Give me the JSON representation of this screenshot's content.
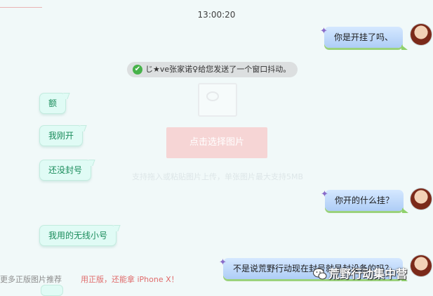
{
  "timestamp": "13:00:20",
  "upload": {
    "button_label": "点击选择图片",
    "hint": "支持拖入或粘贴图片上传，单张图片最大支持5MB"
  },
  "messages": [
    {
      "side": "right",
      "text": "你是开挂了吗、"
    },
    {
      "side": "left",
      "text": "额"
    },
    {
      "side": "left",
      "text": "我刚开"
    },
    {
      "side": "left",
      "text": "还没封号"
    },
    {
      "side": "right",
      "text": "你开的什么挂？"
    },
    {
      "side": "left",
      "text": "我用的无线小号"
    },
    {
      "side": "right",
      "text": "不是说荒野行动现在封号就是封设备的吗？"
    }
  ],
  "system_notice": {
    "text": "じ★ve张家诺♀给您发送了一个窗口抖动。",
    "icon": "check-icon"
  },
  "footer": {
    "recommend_label": "更多正版图片推荐",
    "recommend_link": "用正版，还能拿 iPhone X！"
  },
  "watermark": {
    "text": "荒野行动集中营",
    "icon": "wechat-icon"
  },
  "colors": {
    "right_bubble": "#aecdf6",
    "left_bubble": "#e0fbf5",
    "left_text": "#1a8c5b",
    "upload_button": "#f6d5d5"
  }
}
